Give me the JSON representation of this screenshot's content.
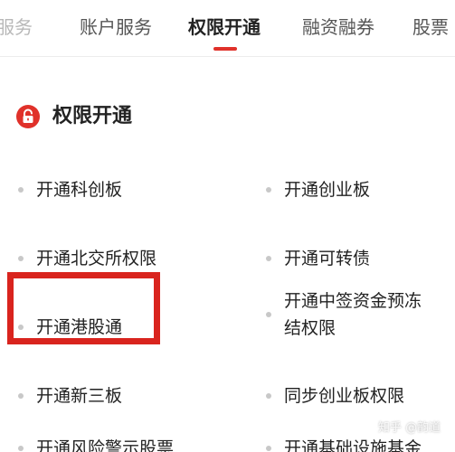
{
  "tabs": [
    {
      "label": "服务"
    },
    {
      "label": "账户服务"
    },
    {
      "label": "权限开通"
    },
    {
      "label": "融资融券"
    },
    {
      "label": "股票"
    }
  ],
  "section": {
    "title": "权限开通",
    "icon": "lock-icon"
  },
  "items": [
    {
      "label": "开通科创板"
    },
    {
      "label": "开通创业板"
    },
    {
      "label": "开通北交所权限"
    },
    {
      "label": "开通可转债"
    },
    {
      "label": "开通港股通"
    },
    {
      "label": "开通中签资金预冻结权限"
    },
    {
      "label": "开通新三板"
    },
    {
      "label": "同步创业板权限"
    },
    {
      "label": "开通风险警示股票"
    },
    {
      "label": "开通基础设施基金"
    }
  ],
  "watermark": "知乎 @韵道",
  "colors": {
    "accent": "#e0312a",
    "highlight": "#d9241e"
  }
}
